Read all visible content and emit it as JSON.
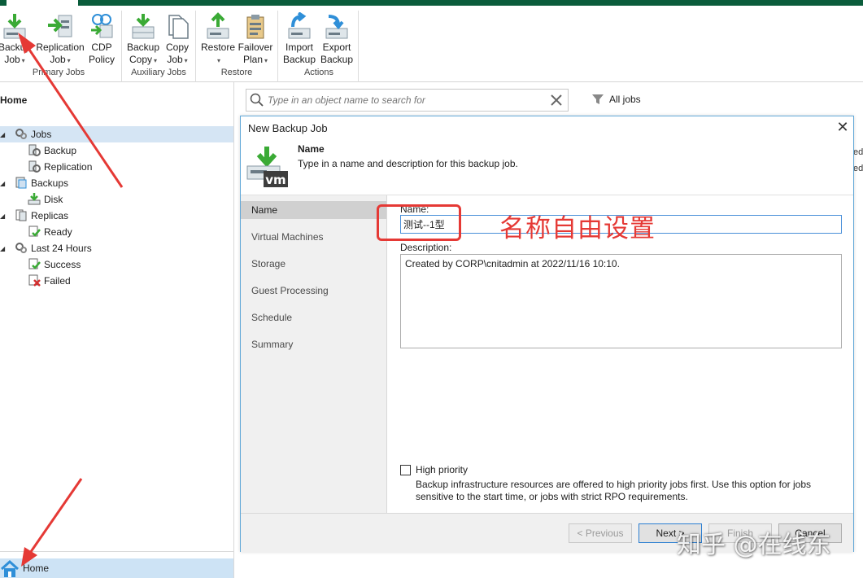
{
  "ribbon": {
    "buttons": [
      {
        "line1": "Backup",
        "line2": "Job",
        "icon": "backup-job-icon"
      },
      {
        "line1": "Replication",
        "line2": "Job",
        "icon": "replication-job-icon"
      },
      {
        "line1": "CDP",
        "line2": "Policy",
        "icon": "cdp-policy-icon"
      },
      {
        "line1": "Backup",
        "line2": "Copy",
        "icon": "backup-copy-icon"
      },
      {
        "line1": "Copy",
        "line2": "Job",
        "icon": "copy-job-icon"
      },
      {
        "line1": "Restore",
        "line2": "",
        "icon": "restore-icon"
      },
      {
        "line1": "Failover",
        "line2": "Plan",
        "icon": "failover-plan-icon"
      },
      {
        "line1": "Import",
        "line2": "Backup",
        "icon": "import-backup-icon"
      },
      {
        "line1": "Export",
        "line2": "Backup",
        "icon": "export-backup-icon"
      }
    ],
    "groups": [
      "Primary Jobs",
      "Auxiliary Jobs",
      "Restore",
      "Actions"
    ]
  },
  "nav": {
    "title": "Home",
    "tree": [
      {
        "label": "Jobs",
        "icon": "gears-icon",
        "selected": true
      },
      {
        "label": "Backup",
        "icon": "backup-job-icon"
      },
      {
        "label": "Replication",
        "icon": "replication-icon"
      },
      {
        "label": "Backups",
        "icon": "backups-icon"
      },
      {
        "label": "Disk",
        "icon": "disk-icon"
      },
      {
        "label": "Replicas",
        "icon": "replicas-icon"
      },
      {
        "label": "Ready",
        "icon": "ready-icon"
      },
      {
        "label": "Last 24 Hours",
        "icon": "history-icon"
      },
      {
        "label": "Success",
        "icon": "success-icon"
      },
      {
        "label": "Failed",
        "icon": "failed-icon"
      }
    ],
    "bottom_home": "Home"
  },
  "search": {
    "placeholder": "Type in an object name to search for",
    "filter_label": "All jobs"
  },
  "dialog": {
    "title": "New Backup Job",
    "step_title": "Name",
    "step_desc": "Type in a name and description for this backup job.",
    "steps": [
      "Name",
      "Virtual Machines",
      "Storage",
      "Guest Processing",
      "Schedule",
      "Summary"
    ],
    "active_step": 0,
    "name_label": "Name:",
    "name_value": "测试--1型",
    "description_label": "Description:",
    "description_value": "Created by CORP\\cnitadmin at 2022/11/16 10:10.",
    "high_priority_label": "High priority",
    "high_priority_checked": false,
    "high_priority_note": "Backup infrastructure resources are offered to high priority jobs first. Use this option for jobs sensitive to the start time, or jobs with strict RPO requirements.",
    "buttons": {
      "previous": "< Previous",
      "next": "Next >",
      "finish": "Finish",
      "cancel": "Cancel"
    }
  },
  "annotation": {
    "text": "名称自由设置",
    "color": "#e53935"
  },
  "watermark": "知乎 @在线东",
  "colors": {
    "accent": "#0a5c3b",
    "selection": "#d5e5f4",
    "icon_green": "#3aaa35",
    "icon_blue": "#2f8fd8"
  }
}
